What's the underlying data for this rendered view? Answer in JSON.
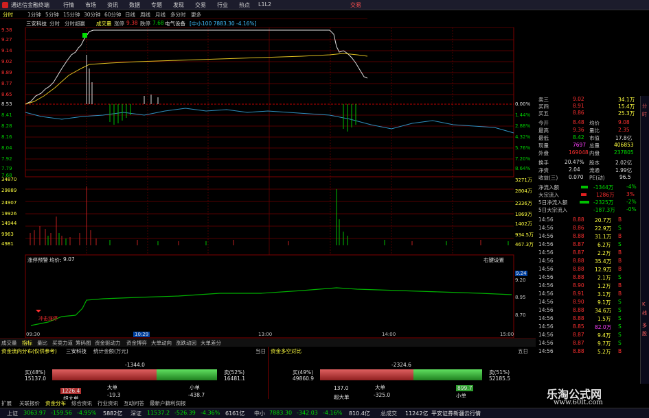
{
  "app": {
    "title": "通达信金融终端",
    "corner_label": "交易"
  },
  "menu": [
    "行情",
    "市场",
    "资讯",
    "数据",
    "专题",
    "发现",
    "交易",
    "行业",
    "热点",
    "L1L2"
  ],
  "toolbar": {
    "items": [
      "分时",
      "1分钟",
      "5分钟",
      "15分钟",
      "30分钟",
      "60分钟",
      "日线",
      "周线",
      "月线",
      "多分时",
      "更多"
    ]
  },
  "infobar": {
    "stock_name": "三安科技",
    "tabs": [
      "分时",
      "分时超赢"
    ],
    "volume_label": "成交量",
    "limit_up_label": "涨停",
    "limit_up_value": "9.38",
    "limit_down_label": "跌停",
    "limit_down_value": "7.68",
    "sector": "电气设备",
    "index_info": "[中小100 7883.30 -4.16%]"
  },
  "price_axis_left": [
    "9.38",
    "9.27",
    "9.14",
    "9.02",
    "8.89",
    "8.77",
    "8.65",
    "8.53",
    "8.41",
    "8.28",
    "8.16",
    "8.04",
    "7.92",
    "7.79",
    "7.68"
  ],
  "price_axis_right": [
    "0.00%",
    "1.44%",
    "2.88%",
    "4.32%",
    "5.76%",
    "7.20%",
    "8.64%"
  ],
  "volume_axis_left": [
    "34870",
    "29889",
    "24907",
    "19926",
    "14944",
    "9963",
    "4981"
  ],
  "volume_axis_right": [
    "3271万",
    "2804万",
    "2336万",
    "1869万",
    "1402万",
    "934.5万",
    "467.3万"
  ],
  "alert_panel": {
    "title": "涨停预警",
    "avg_label": "均价:",
    "avg_value": "9.07",
    "top_right": "右键设置",
    "axis": [
      "9.24",
      "9.20",
      "8.95",
      "8.70"
    ],
    "marker_label": "冲击涨停"
  },
  "time_axis": [
    "09:30",
    "10:29",
    "13:00",
    "14:00",
    "15:00"
  ],
  "order_book_partial": [
    {
      "label": "卖三",
      "price": "9.02",
      "vol": "34.1万"
    },
    {
      "label": "买四",
      "price": "8.91",
      "vol": "15.4万"
    },
    {
      "label": "买五",
      "price": "8.86",
      "vol": "25.3万"
    }
  ],
  "quote_stats": [
    {
      "l1": "今开",
      "v1": "8.48",
      "l2": "均价",
      "v2": "9.08"
    },
    {
      "l1": "最高",
      "v1": "9.36",
      "l2": "量比",
      "v2": "2.35"
    },
    {
      "l1": "最低",
      "v1": "8.42",
      "l2": "市值",
      "v2": "17.8亿"
    },
    {
      "l1": "现量",
      "v1": "7697",
      "l2": "总量",
      "v2": "406853"
    },
    {
      "l1": "外盘",
      "v1": "169048",
      "l2": "内盘",
      "v2": "237805"
    },
    {
      "l1": "换手",
      "v1": "20.47%",
      "l2": "股本",
      "v2": "2.02亿"
    },
    {
      "l1": "净资",
      "v1": "2.04",
      "l2": "流通",
      "v2": "1.99亿"
    },
    {
      "l1": "收益(三)",
      "v1": "0.070",
      "l2": "PE(动)",
      "v2": "96.5"
    }
  ],
  "flow_stats": [
    {
      "label": "净流入额",
      "value": "-1344万",
      "pct": "-4%"
    },
    {
      "label": "大宗流入",
      "value": "1286万",
      "pct": "3%"
    },
    {
      "label": "5日净流入额",
      "value": "-2325万",
      "pct": "-2%"
    },
    {
      "label": "5日大宗流入",
      "value": "-187.3万",
      "pct": "-0%"
    }
  ],
  "ticks": [
    {
      "t": "14:56",
      "p": "8.88",
      "v": "20.7万",
      "s": "B"
    },
    {
      "t": "14:56",
      "p": "8.86",
      "v": "22.9万",
      "s": "S"
    },
    {
      "t": "14:56",
      "p": "8.88",
      "v": "31.1万",
      "s": "B"
    },
    {
      "t": "14:56",
      "p": "8.87",
      "v": "6.2万",
      "s": "S"
    },
    {
      "t": "14:56",
      "p": "8.87",
      "v": "2.2万",
      "s": "B"
    },
    {
      "t": "14:56",
      "p": "8.88",
      "v": "35.4万",
      "s": "B"
    },
    {
      "t": "14:56",
      "p": "8.88",
      "v": "12.9万",
      "s": "B"
    },
    {
      "t": "14:56",
      "p": "8.88",
      "v": "2.1万",
      "s": "S"
    },
    {
      "t": "14:56",
      "p": "8.90",
      "v": "1.2万",
      "s": "B"
    },
    {
      "t": "14:56",
      "p": "8.91",
      "v": "3.1万",
      "s": "B"
    },
    {
      "t": "14:56",
      "p": "8.90",
      "v": "9.1万",
      "s": "S"
    },
    {
      "t": "14:56",
      "p": "8.88",
      "v": "34.6万",
      "s": "S"
    },
    {
      "t": "14:56",
      "p": "8.88",
      "v": "1.5万",
      "s": "S"
    },
    {
      "t": "14:56",
      "p": "8.85",
      "v": "82.0万",
      "s": "S"
    },
    {
      "t": "14:56",
      "p": "8.87",
      "v": "9.4万",
      "s": "S"
    },
    {
      "t": "14:56",
      "p": "8.87",
      "v": "9.7万",
      "s": "S"
    },
    {
      "t": "14:56",
      "p": "8.88",
      "v": "5.2万",
      "s": "B"
    }
  ],
  "bottom_tabs": [
    "成交量",
    "指标",
    "量比",
    "买卖力道",
    "筹码图",
    "资金驱动力",
    "资金博弈",
    "大单动向",
    "涨跌动因",
    "大单差分"
  ],
  "fund_left": {
    "title": "资金流向分布(仅供参考)",
    "stock": "三安科技",
    "unit": "统计金额(万元)",
    "day": "当日",
    "buy_label": "买(48%)",
    "buy_value": "15137.0",
    "sell_label": "卖(52%)",
    "sell_value": "16481.1",
    "net": "-1344.0",
    "big_label": "大单",
    "small_label": "小单",
    "super_label": "超大单",
    "v1": "1226.4",
    "v2": "-19.3",
    "v3": "-438.7"
  },
  "fund_right": {
    "title": "资金多空对比",
    "day": "五日",
    "buy_label": "买(49%)",
    "buy_value": "49860.9",
    "sell_label": "卖(51%)",
    "sell_value": "52185.5",
    "net": "-2324.6",
    "big_label": "大单",
    "small_label": "小单",
    "super_label": "超大单",
    "v1": "137.0",
    "v2": "-325.0",
    "v3": "899.7"
  },
  "sub_tabs": [
    "扩展",
    "关联报价",
    "资金分布",
    "综合资讯",
    "行业资讯",
    "互动问答",
    "最新户籍利润报"
  ],
  "status": {
    "sh_label": "上证",
    "sh_value": "3063.97",
    "sh_change": "-159.56",
    "sh_pct": "-4.95%",
    "sh_amount": "5882亿",
    "sz_label": "深证",
    "sz_value": "11537.2",
    "sz_change": "-526.39",
    "sz_pct": "-4.36%",
    "sz_amount": "6161亿",
    "zx_label": "中小",
    "zx_value": "7883.30",
    "zx_change": "-342.03",
    "zx_pct": "-4.16%",
    "zx_amount": "810.4亿",
    "total_label": "总成交",
    "total_value": "11242亿",
    "ticker": "平安证券新疆云行情"
  },
  "watermark": {
    "title": "乐淘公式网",
    "url": "www.60lt.com"
  },
  "sidebar_labels": [
    "分",
    "时",
    "K",
    "线",
    "多",
    "股"
  ]
}
